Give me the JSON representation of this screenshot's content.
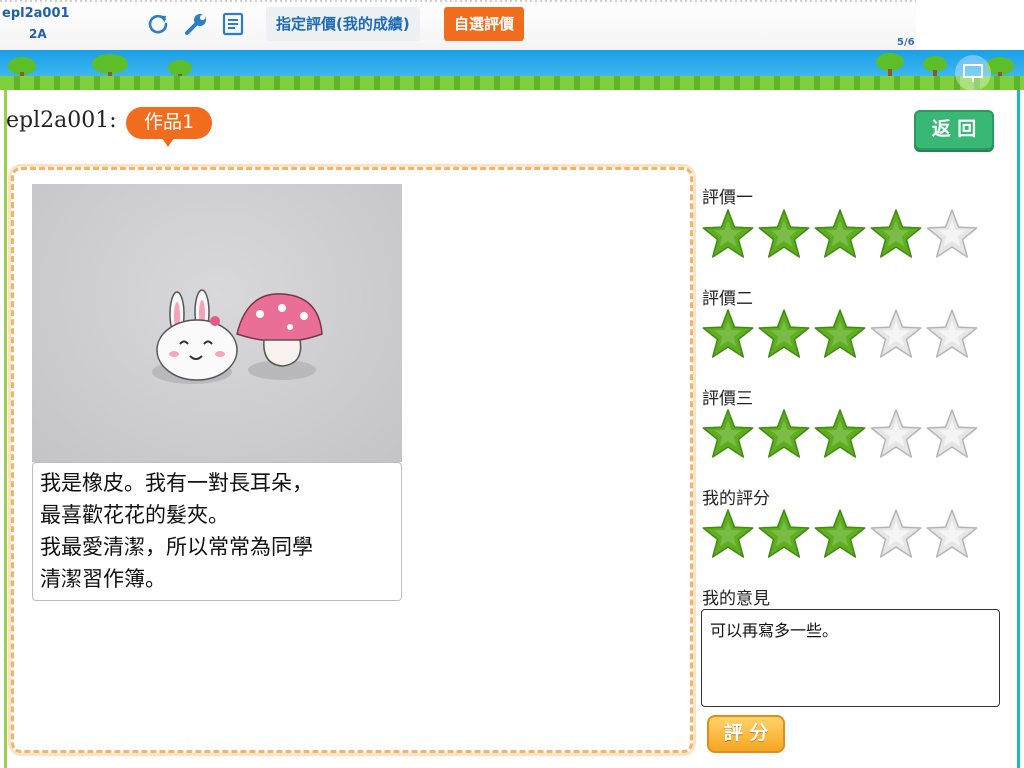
{
  "topbar": {
    "user_id": "epl2a001",
    "class_name": "2A",
    "icons": [
      "refresh-icon",
      "wrench-icon",
      "notes-icon"
    ],
    "assigned_button": "指定評價(我的成績)",
    "self_button": "自選評價",
    "page_count": "5/6"
  },
  "work": {
    "owner": "epl2a001:",
    "badge": "作品1",
    "back_button": "返 回",
    "caption_lines": [
      "我是橡皮。我有一對長耳朵，",
      "最喜歡花花的髮夾。",
      "我最愛清潔，所以常常為同學",
      "清潔習作簿。"
    ]
  },
  "ratings": [
    {
      "label": "評價一",
      "stars": 4,
      "max": 5
    },
    {
      "label": "評價二",
      "stars": 3,
      "max": 5
    },
    {
      "label": "評價三",
      "stars": 3,
      "max": 5
    },
    {
      "label": "我的評分",
      "stars": 3,
      "max": 5
    }
  ],
  "comment": {
    "label": "我的意見",
    "value": "可以再寫多一些。"
  },
  "score_button": "評 分",
  "colors": {
    "accent_orange": "#f26c1e",
    "star_filled": "#5fae1f",
    "star_empty": "#e6e6e6",
    "back_button": "#38b775",
    "link_blue": "#1c5fae"
  }
}
